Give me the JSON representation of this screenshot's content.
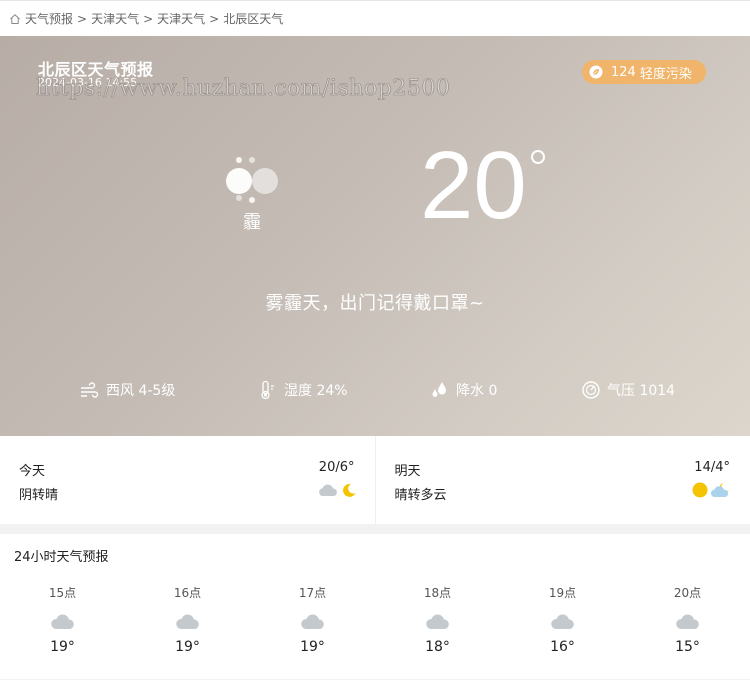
{
  "breadcrumb": {
    "items": [
      "天气预报",
      "天津天气",
      "天津天气",
      "北辰区天气"
    ],
    "separator": ">"
  },
  "hero": {
    "title": "北辰区天气预报",
    "time": "2024-03-16 14:55",
    "watermark": "https://www.huzhan.com/ishop2500",
    "aqi": {
      "value": "124",
      "label": "轻度污染",
      "color": "#f0b46a"
    },
    "condition": "霾",
    "condition_icon": "haze-icon",
    "temperature": "20",
    "tip": "雾霾天，出门记得戴口罩~",
    "stats": [
      {
        "icon": "wind-icon",
        "text": "西风 4-5级"
      },
      {
        "icon": "thermometer-icon",
        "text": "湿度 24%"
      },
      {
        "icon": "raindrop-icon",
        "text": "降水 0"
      },
      {
        "icon": "pressure-gauge-icon",
        "text": "气压 1014"
      }
    ]
  },
  "days": [
    {
      "name": "今天",
      "range": "20/6°",
      "desc": "阴转晴",
      "icons": [
        "cloud-icon",
        "moon-icon"
      ]
    },
    {
      "name": "明天",
      "range": "14/4°",
      "desc": "晴转多云",
      "icons": [
        "sun-icon",
        "cloud-night-icon"
      ]
    }
  ],
  "hourly": {
    "title": "24小时天气预报",
    "hours": [
      {
        "label": "15点",
        "temp": "19°",
        "icon": "cloud-icon"
      },
      {
        "label": "16点",
        "temp": "19°",
        "icon": "cloud-icon"
      },
      {
        "label": "17点",
        "temp": "19°",
        "icon": "cloud-icon"
      },
      {
        "label": "18点",
        "temp": "18°",
        "icon": "cloud-icon"
      },
      {
        "label": "19点",
        "temp": "16°",
        "icon": "cloud-icon"
      },
      {
        "label": "20点",
        "temp": "15°",
        "icon": "cloud-icon"
      }
    ]
  }
}
